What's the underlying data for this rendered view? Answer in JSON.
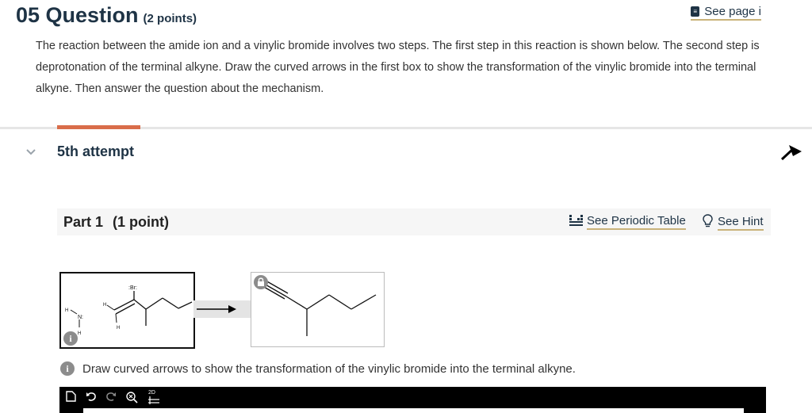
{
  "question": {
    "number": "05 Question",
    "points": "(2 points)",
    "see_page": "See page i",
    "text": "The reaction between the amide ion and a vinylic bromide involves two steps. The first step in this reaction is shown below. The second step is deprotonation of the terminal alkyne. Draw the curved arrows in the first box to show the transformation of the vinylic bromide into the terminal alkyne. Then answer the question about the mechanism."
  },
  "attempt": {
    "label": "5th attempt"
  },
  "part": {
    "title": "Part 1",
    "points": "(1 point)",
    "periodic_table": "See Periodic Table",
    "hint": "See Hint"
  },
  "reactant_labels": {
    "br": ":Br:",
    "n": "N:",
    "h_top": "H",
    "h_bottom": "H",
    "h_alkene_left": "H",
    "h_alkene_bottom": "H"
  },
  "info_icon": "i",
  "instruction": "Draw curved arrows to show the transformation of the vinylic bromide into the terminal alkyne.",
  "toolbar": {
    "mode_2d": "2D"
  },
  "colors": {
    "heading": "#1e3345",
    "tab_accent": "#d96d4a",
    "link_underline": "#c9b27a"
  }
}
